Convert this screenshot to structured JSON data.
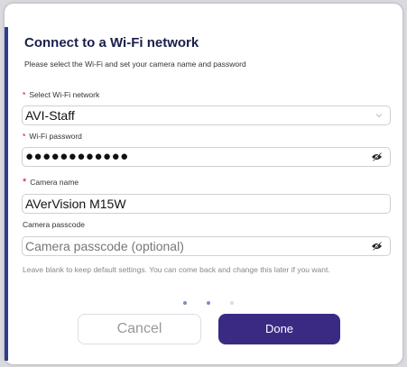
{
  "dialog": {
    "title": "Connect to a Wi-Fi network",
    "subtitle": "Please select the Wi-Fi and set your camera name and password"
  },
  "wifi_network": {
    "required_mark": "*",
    "label": "Select Wi-Fi network",
    "value": "AVI-Staff"
  },
  "wifi_password": {
    "required_mark": "*",
    "label": "Wi-Fi password",
    "masked_value": "●●●●●●●●●●●●"
  },
  "camera_name": {
    "required_mark": "*",
    "label": "Camera name",
    "value": "AVerVision M15W"
  },
  "camera_passcode": {
    "label": "Camera passcode",
    "placeholder": "Camera passcode (optional)",
    "hint": "Leave blank to keep default settings. You can come back and change this later if you want."
  },
  "steps": {
    "total": 3,
    "current": 2
  },
  "buttons": {
    "cancel": "Cancel",
    "done": "Done"
  },
  "colors": {
    "accent": "#3a2a83",
    "title": "#1a1f4a",
    "required": "#d0021b",
    "step_active": "#7a8fc4",
    "step_inactive": "#d8dce6"
  },
  "icons": {
    "wifi_dropdown": "chevron-down-icon",
    "password_toggle": "eye-off-icon",
    "passcode_toggle": "eye-off-icon"
  }
}
